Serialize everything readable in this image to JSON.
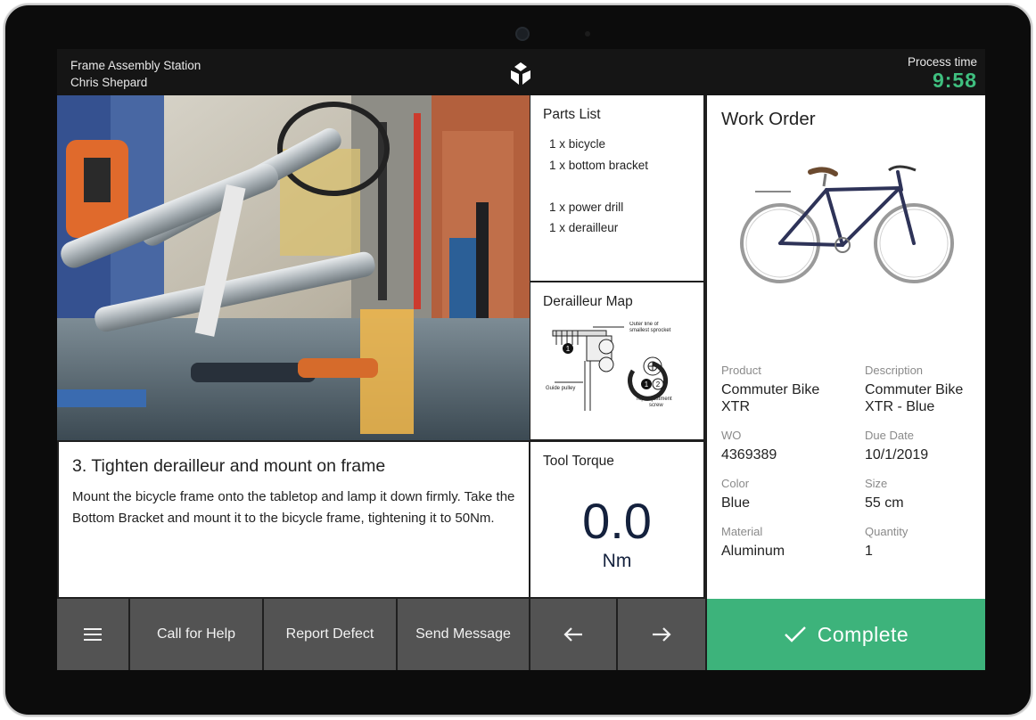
{
  "header": {
    "station_name": "Frame Assembly Station",
    "operator_name": "Chris Shepard",
    "process_time_label": "Process time",
    "process_time_value": "9:58"
  },
  "step": {
    "title": "3. Tighten derailleur and mount on frame",
    "body": "Mount the bicycle frame onto the tabletop and lamp it down firmly. Take the Bottom Bracket and mount it to the bicycle frame, tightening it to 50Nm."
  },
  "parts_list": {
    "title": "Parts List",
    "items": [
      "1 x bicycle",
      "1 x bottom bracket",
      "1 x power drill",
      "1 x derailleur"
    ]
  },
  "derailleur_map": {
    "title": "Derailleur Map",
    "labels": {
      "outer_line_1": "Outer line of",
      "outer_line_2": "smallest sprocket",
      "guide_pulley": "Guide pulley",
      "top_adjust_1": "Top adjustment",
      "top_adjust_2": "screw",
      "n1": "1",
      "n2": "2"
    }
  },
  "tool_torque": {
    "title": "Tool Torque",
    "value": "0.0",
    "unit": "Nm"
  },
  "work_order": {
    "title": "Work Order",
    "fields": {
      "product_label": "Product",
      "product_value": "Commuter Bike XTR",
      "description_label": "Description",
      "description_value": "Commuter Bike XTR - Blue",
      "wo_label": "WO",
      "wo_value": "4369389",
      "due_label": "Due Date",
      "due_value": "10/1/2019",
      "color_label": "Color",
      "color_value": "Blue",
      "size_label": "Size",
      "size_value": "55 cm",
      "material_label": "Material",
      "material_value": "Aluminum",
      "quantity_label": "Quantity",
      "quantity_value": "1"
    }
  },
  "bottom_bar": {
    "menu_icon": "hamburger-menu-icon",
    "call_help": "Call for Help",
    "report_defect": "Report Defect",
    "send_message": "Send Message",
    "prev_icon": "arrow-left-icon",
    "next_icon": "arrow-right-icon",
    "complete": "Complete",
    "complete_icon": "checkmark-icon"
  },
  "colors": {
    "accent_green": "#3db37b",
    "timer_green": "#3fbf7f",
    "button_gray": "#535353",
    "topbar": "#151515",
    "torque_text": "#14213d",
    "bike_frame": "#2e3358"
  }
}
